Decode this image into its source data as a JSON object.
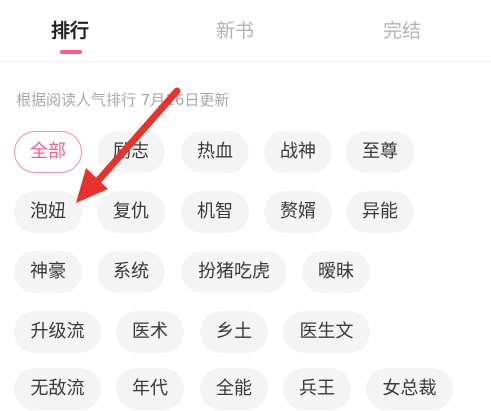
{
  "tabs": [
    {
      "label": "排行",
      "active": true
    },
    {
      "label": "新书",
      "active": false
    },
    {
      "label": "完结",
      "active": false
    }
  ],
  "subtitle": "根据阅读人气排行 7月16日更新",
  "accent_color": "#ff5c8a",
  "annotation": {
    "color": "#e8322b",
    "icon": "arrow-icon"
  },
  "tags": [
    {
      "label": "全部",
      "selected": true
    },
    {
      "label": "励志"
    },
    {
      "label": "热血"
    },
    {
      "label": "战神"
    },
    {
      "label": "至尊"
    },
    {
      "label": "泡妞"
    },
    {
      "label": "复仇"
    },
    {
      "label": "机智"
    },
    {
      "label": "赘婿"
    },
    {
      "label": "异能"
    },
    {
      "label": "神豪"
    },
    {
      "label": "系统"
    },
    {
      "label": "扮猪吃虎"
    },
    {
      "label": "暧昧"
    },
    {
      "label": "升级流"
    },
    {
      "label": "医术"
    },
    {
      "label": "乡土"
    },
    {
      "label": "医生文"
    },
    {
      "label": "无敌流"
    },
    {
      "label": "年代"
    },
    {
      "label": "全能"
    },
    {
      "label": "兵王"
    },
    {
      "label": "女总裁"
    }
  ]
}
